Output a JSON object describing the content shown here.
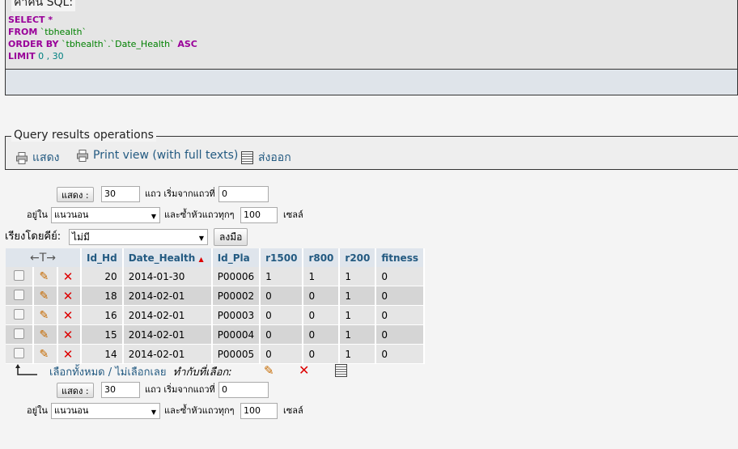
{
  "sql_panel": {
    "legend": "คำค้น SQL:",
    "lines": [
      {
        "kw": "SELECT",
        "rest": " *",
        "rest_class": "kw"
      },
      {
        "kw": "FROM",
        "rest": " `tbhealth`",
        "rest_class": "str"
      },
      {
        "kw": "ORDER BY",
        "rest": " `tbhealth`.`Date_Health`",
        "rest_class": "str",
        "tail": " ASC"
      },
      {
        "kw": "LIMIT",
        "rest": " 0 , 30",
        "rest_class": "num"
      }
    ]
  },
  "operations": {
    "legend": "Query results operations",
    "show_label": "แสดง",
    "print_label": "Print view (with full texts)",
    "export_label": "ส่งออก"
  },
  "nav_top": {
    "show_button": "แสดง :",
    "rows_value": "30",
    "rows_label": "แถว เริ่มจากแถวที่",
    "start_value": "0",
    "in_label": "อยู่ใน",
    "mode_value": "แนวนอน",
    "repeat_label": "และซ้ำหัวแถวทุกๆ",
    "repeat_value": "100",
    "cells_label": "เซลล์"
  },
  "sort": {
    "label": "เรียงโดยคีย์:",
    "value": "ไม่มี",
    "button": "ลงมือ"
  },
  "table": {
    "columns": [
      "Id_Hd",
      "Date_Health",
      "Id_Pla",
      "r1500",
      "r800",
      "r200",
      "fitness"
    ],
    "arrows": "←T→",
    "rows": [
      [
        "20",
        "2014-01-30",
        "P00006",
        "1",
        "1",
        "1",
        "0"
      ],
      [
        "18",
        "2014-02-01",
        "P00002",
        "0",
        "0",
        "1",
        "0"
      ],
      [
        "16",
        "2014-02-01",
        "P00003",
        "0",
        "0",
        "1",
        "0"
      ],
      [
        "15",
        "2014-02-01",
        "P00004",
        "0",
        "0",
        "1",
        "0"
      ],
      [
        "14",
        "2014-02-01",
        "P00005",
        "0",
        "0",
        "1",
        "0"
      ]
    ]
  },
  "bulk": {
    "select_all": "เลือกทั้งหมด",
    "sep": " / ",
    "unselect_all": "ไม่เลือกเลย",
    "with_selected": "ทำกับที่เลือก:"
  },
  "nav_bottom": {
    "show_button": "แสดง :",
    "rows_value": "30",
    "rows_label": "แถว เริ่มจากแถวที่",
    "start_value": "0",
    "in_label": "อยู่ใน",
    "mode_value": "แนวนอน",
    "repeat_label": "และซ้ำหัวแถวทุกๆ",
    "repeat_value": "100",
    "cells_label": "เซลล์"
  },
  "colors": {
    "link": "#235a81",
    "keyword": "#990099",
    "string": "#008000",
    "number": "#008080",
    "delete": "#dd0000"
  }
}
